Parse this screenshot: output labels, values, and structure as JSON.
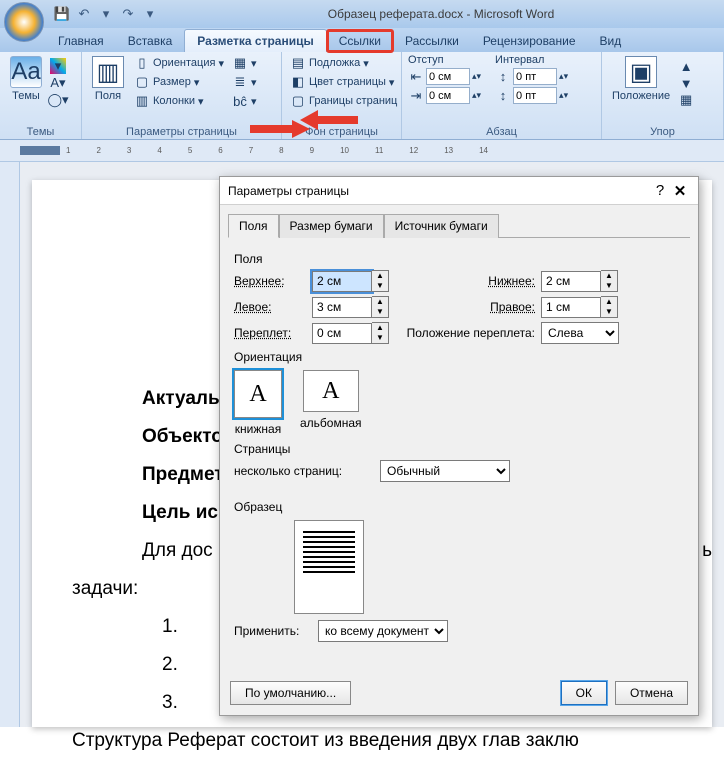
{
  "titlebar": {
    "doc_name": "Образец реферата.docx - Microsoft Word"
  },
  "qat": {
    "save": "💾",
    "undo": "↶",
    "redo": "↷",
    "more": "▾"
  },
  "tabs": {
    "home": "Главная",
    "insert": "Вставка",
    "layout": "Разметка страницы",
    "references": "Ссылки",
    "mailings": "Рассылки",
    "review": "Рецензирование",
    "view": "Вид"
  },
  "ribbon": {
    "themes_group": "Темы",
    "themes_btn": "Темы",
    "page_setup_group": "Параметры страницы",
    "fields_btn": "Поля",
    "orientation": "Ориентация",
    "size": "Размер",
    "columns": "Колонки",
    "breaks": "▦",
    "line_numbers": "≣",
    "hyphenation": "bĉ",
    "page_bg_group": "Фон страницы",
    "watermark": "Подложка",
    "page_color": "Цвет страницы",
    "borders": "Границы страниц",
    "paragraph_group": "Абзац",
    "indent_label": "Отступ",
    "spacing_label": "Интервал",
    "indent_left": "0 см",
    "indent_right": "0 см",
    "space_before": "0 пт",
    "space_after": "0 пт",
    "arrange_group": "Упор",
    "position": "Положение"
  },
  "ruler_nums": [
    "1",
    "",
    "1",
    "2",
    "3",
    "4",
    "5",
    "6",
    "7",
    "8",
    "9",
    "10",
    "11",
    "12",
    "13",
    "14"
  ],
  "document": {
    "lines": [
      "Актуаль",
      "Объекто",
      "Предмет",
      "Цель ис",
      "Для  дос",
      "задачи:"
    ],
    "li1": "1.",
    "li2": "2.",
    "li3": "3.",
    "tail_right": "ь",
    "struct": "Структура  Реферат состоит из введения  двух глав  заклю"
  },
  "dialog": {
    "title": "Параметры страницы",
    "help": "?",
    "close": "✕",
    "tab_fields": "Поля",
    "tab_paper": "Размер бумаги",
    "tab_source": "Источник бумаги",
    "section_fields": "Поля",
    "top_lbl": "Верхнее:",
    "top_val": "2 см",
    "bottom_lbl": "Нижнее:",
    "bottom_val": "2 см",
    "left_lbl": "Левое:",
    "left_val": "3 см",
    "right_lbl": "Правое:",
    "right_val": "1 см",
    "gutter_lbl": "Переплет:",
    "gutter_val": "0 см",
    "gutter_pos_lbl": "Положение переплета:",
    "gutter_pos_val": "Слева",
    "section_orientation": "Ориентация",
    "orient_portrait": "книжная",
    "orient_landscape": "альбомная",
    "section_pages": "Страницы",
    "multi_pages_lbl": "несколько страниц:",
    "multi_pages_val": "Обычный",
    "section_preview": "Образец",
    "apply_lbl": "Применить:",
    "apply_val": "ко всему документу",
    "defaults_btn": "По умолчанию...",
    "ok_btn": "ОК",
    "cancel_btn": "Отмена"
  }
}
